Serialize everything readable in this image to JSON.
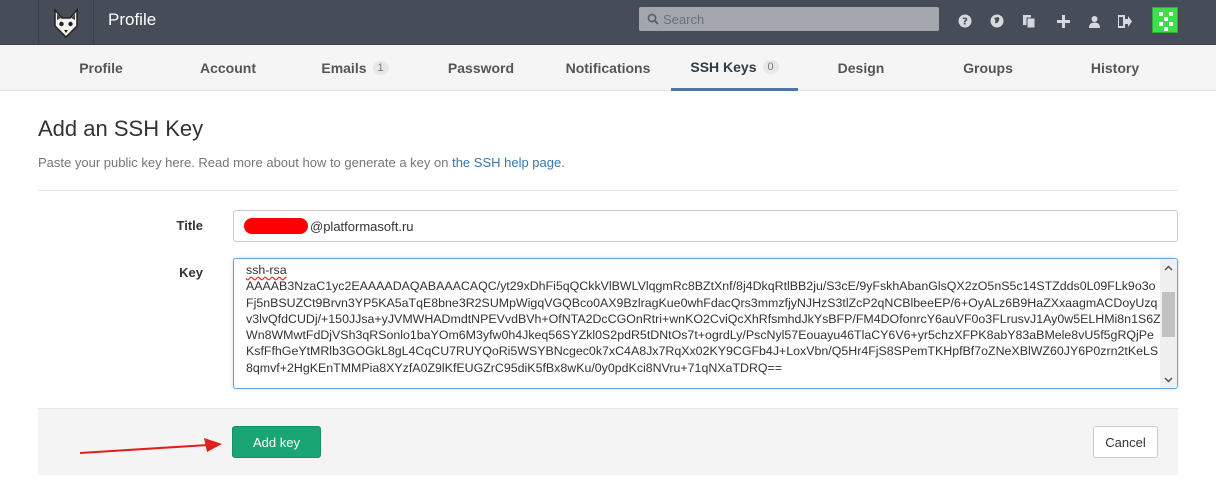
{
  "header": {
    "app_title": "Profile",
    "search_placeholder": "Search",
    "icons": [
      "help-icon",
      "globe-icon",
      "copy-icon",
      "plus-icon",
      "user-icon",
      "sign-out-icon"
    ]
  },
  "tabs": [
    {
      "label": "Profile",
      "badge": null
    },
    {
      "label": "Account",
      "badge": null
    },
    {
      "label": "Emails",
      "badge": "1"
    },
    {
      "label": "Password",
      "badge": null
    },
    {
      "label": "Notifications",
      "badge": null
    },
    {
      "label": "SSH Keys",
      "badge": "0",
      "active": true
    },
    {
      "label": "Design",
      "badge": null
    },
    {
      "label": "Groups",
      "badge": null
    },
    {
      "label": "History",
      "badge": null
    }
  ],
  "page": {
    "title": "Add an SSH Key",
    "subtitle_prefix": "Paste your public key here. Read more about how to generate a key on ",
    "subtitle_link": "the SSH help page",
    "subtitle_suffix": "."
  },
  "form": {
    "title_label": "Title",
    "title_value": "@platformasoft.ru",
    "key_label": "Key",
    "key_prefix": "ssh-rsa",
    "key_value": "AAAAB3NzaC1yc2EAAAADAQABAAACAQC/yt29xDhFi5qQCkkVlBWLVlqgmRc8BZtXnf/8j4DkqRtlBB2ju/S3cE/9yFskhAbanGlsQX2zO5nS5c14STZdds0L09FLk9o3oFj5nBSUZCt9Brvn3YP5KA5aTqE8bne3R2SUMpWigqVGQBco0AX9BzlragKue0whFdacQrs3mmzfjyNJHzS3tlZcP2qNCBlbeeEP/6+OyALz6B9HaZXxaagmACDoyUzqv3lvQfdCUDj/+150JJsa+yJVMWHADmdtNPEVvdBVh+OfNTA2DcCGOnRtri+wnKO2CviQcXhRfsmhdJkYsBFP/FM4DOfonrcY6auVF0o3FLrusvJ1Ay0w5ELHMi8n1S6ZWn8WMwtFdDjVSh3qRSonlo1baYOm6M3yfw0h4Jkeq56SYZkl0S2pdR5tDNtOs7t+ogrdLy/PscNyl57Eouayu46TlaCY6V6+yr5chzXFPK8abY83aBMele8vU5f5gRQjPeKsfFfhGeYtMRlb3GOGkL8gL4CqCU7RUYQoRi5WSYBNcgec0k7xC4A8Jx7RqXx02KY9CGFb4J+LoxVbn/Q5Hr4FjS8SPemTKHpfBf7oZNeXBlWZ60JY6P0zrn2tKeLS8qmvf+2HgKEnTMMPia8XYzfA0Z9lKfEUGZrC95diK5fBx8wKu/0y0pdKci8NVru+71qNXaTDRQ=="
  },
  "actions": {
    "add_label": "Add key",
    "cancel_label": "Cancel"
  },
  "colors": {
    "header_bg": "#474d58",
    "add_button": "#1aa574",
    "active_tab_underline": "#4a76a8",
    "annotation_arrow": "#e0201b"
  }
}
